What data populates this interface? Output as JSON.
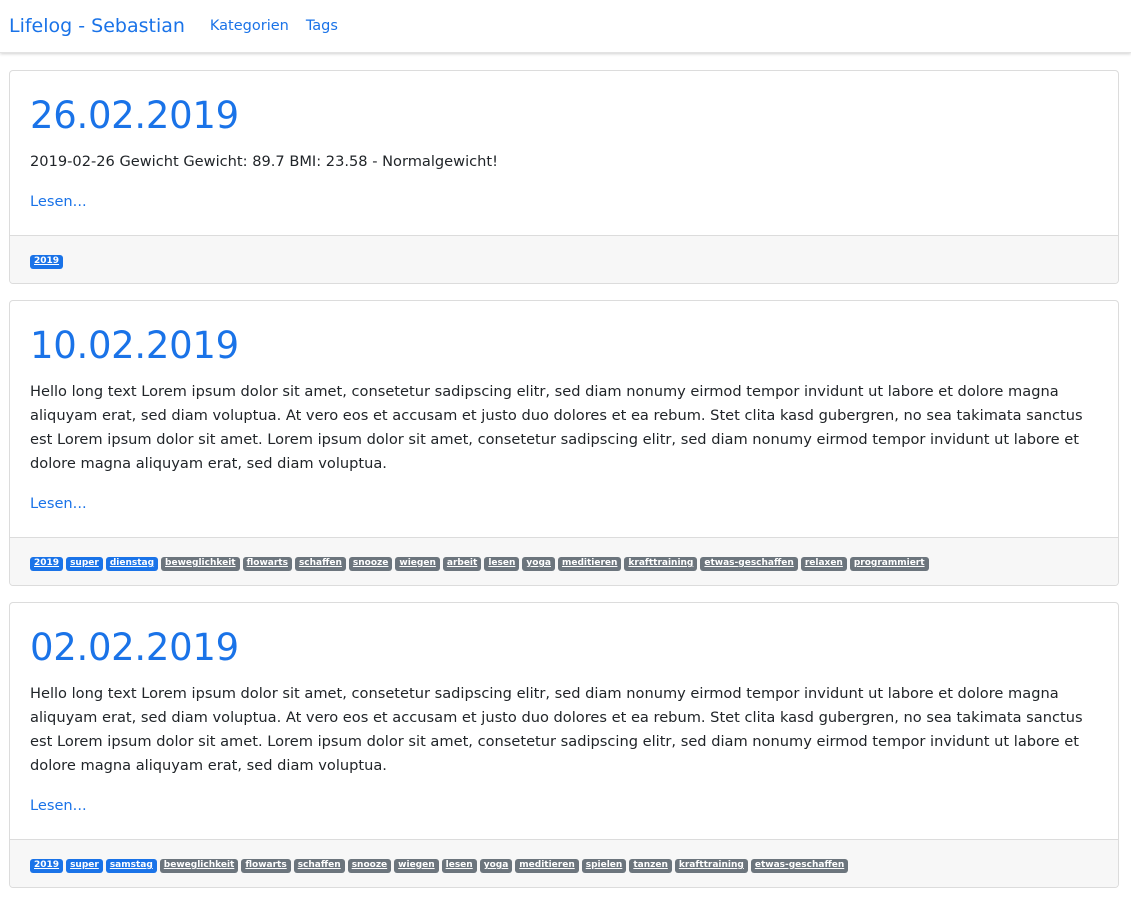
{
  "nav": {
    "brand": "Lifelog - Sebastian",
    "links": [
      "Kategorien",
      "Tags"
    ]
  },
  "colors": {
    "accent": "#1a73e8",
    "tag_primary": "#1a73e8",
    "tag_secondary": "#6c757d"
  },
  "entries": [
    {
      "date": "26.02.2019",
      "text": "2019-02-26 Gewicht Gewicht: 89.7 BMI: 23.58 - Normalgewicht!",
      "read_more": "Lesen...",
      "tags": [
        {
          "label": "2019",
          "style": "primary"
        }
      ]
    },
    {
      "date": "10.02.2019",
      "text": "Hello long text Lorem ipsum dolor sit amet, consetetur sadipscing elitr, sed diam nonumy eirmod tempor invidunt ut labore et dolore magna aliquyam erat, sed diam voluptua. At vero eos et accusam et justo duo dolores et ea rebum. Stet clita kasd gubergren, no sea takimata sanctus est Lorem ipsum dolor sit amet. Lorem ipsum dolor sit amet, consetetur sadipscing elitr, sed diam nonumy eirmod tempor invidunt ut labore et dolore magna aliquyam erat, sed diam voluptua.",
      "read_more": "Lesen...",
      "tags": [
        {
          "label": "2019",
          "style": "primary"
        },
        {
          "label": "super",
          "style": "primary"
        },
        {
          "label": "dienstag",
          "style": "primary"
        },
        {
          "label": "beweglichkeit",
          "style": "secondary"
        },
        {
          "label": "flowarts",
          "style": "secondary"
        },
        {
          "label": "schaffen",
          "style": "secondary"
        },
        {
          "label": "snooze",
          "style": "secondary"
        },
        {
          "label": "wiegen",
          "style": "secondary"
        },
        {
          "label": "arbeit",
          "style": "secondary"
        },
        {
          "label": "lesen",
          "style": "secondary"
        },
        {
          "label": "yoga",
          "style": "secondary"
        },
        {
          "label": "meditieren",
          "style": "secondary"
        },
        {
          "label": "krafttraining",
          "style": "secondary"
        },
        {
          "label": "etwas-geschaffen",
          "style": "secondary"
        },
        {
          "label": "relaxen",
          "style": "secondary"
        },
        {
          "label": "programmiert",
          "style": "secondary"
        }
      ]
    },
    {
      "date": "02.02.2019",
      "text": "Hello long text Lorem ipsum dolor sit amet, consetetur sadipscing elitr, sed diam nonumy eirmod tempor invidunt ut labore et dolore magna aliquyam erat, sed diam voluptua. At vero eos et accusam et justo duo dolores et ea rebum. Stet clita kasd gubergren, no sea takimata sanctus est Lorem ipsum dolor sit amet. Lorem ipsum dolor sit amet, consetetur sadipscing elitr, sed diam nonumy eirmod tempor invidunt ut labore et dolore magna aliquyam erat, sed diam voluptua.",
      "read_more": "Lesen...",
      "tags": [
        {
          "label": "2019",
          "style": "primary"
        },
        {
          "label": "super",
          "style": "primary"
        },
        {
          "label": "samstag",
          "style": "primary"
        },
        {
          "label": "beweglichkeit",
          "style": "secondary"
        },
        {
          "label": "flowarts",
          "style": "secondary"
        },
        {
          "label": "schaffen",
          "style": "secondary"
        },
        {
          "label": "snooze",
          "style": "secondary"
        },
        {
          "label": "wiegen",
          "style": "secondary"
        },
        {
          "label": "lesen",
          "style": "secondary"
        },
        {
          "label": "yoga",
          "style": "secondary"
        },
        {
          "label": "meditieren",
          "style": "secondary"
        },
        {
          "label": "spielen",
          "style": "secondary"
        },
        {
          "label": "tanzen",
          "style": "secondary"
        },
        {
          "label": "krafttraining",
          "style": "secondary"
        },
        {
          "label": "etwas-geschaffen",
          "style": "secondary"
        }
      ]
    }
  ]
}
